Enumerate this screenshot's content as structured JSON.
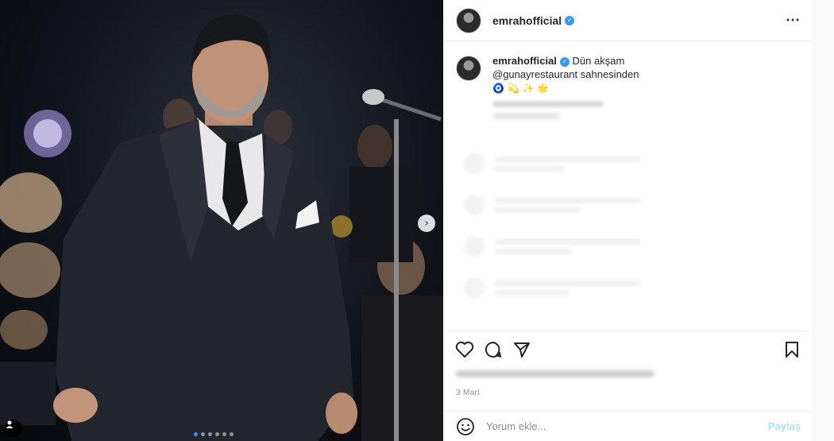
{
  "post": {
    "username": "emrahofficial",
    "more_icon": "⋯",
    "caption_line1": "Dün akşam",
    "caption_line2": "@gunayrestaurant sahnesinden",
    "caption_emojis": "🧿 💫 ✨ 🌟",
    "date": "3 Mart",
    "carousel_dots": 6,
    "carousel_active_index": 0
  },
  "comment_box": {
    "placeholder": "Yorum ekle...",
    "post_label": "Paylaş"
  },
  "icons": {
    "like": "heart-icon",
    "comment": "comment-icon",
    "share": "share-icon",
    "save": "bookmark-icon",
    "next": "chevron-right-icon",
    "emoji": "smile-icon",
    "tag": "user-tag-icon"
  },
  "colors": {
    "accent": "#3897f0",
    "post_button_disabled": "#b2dffc",
    "muted_text": "#8e8e8e"
  }
}
